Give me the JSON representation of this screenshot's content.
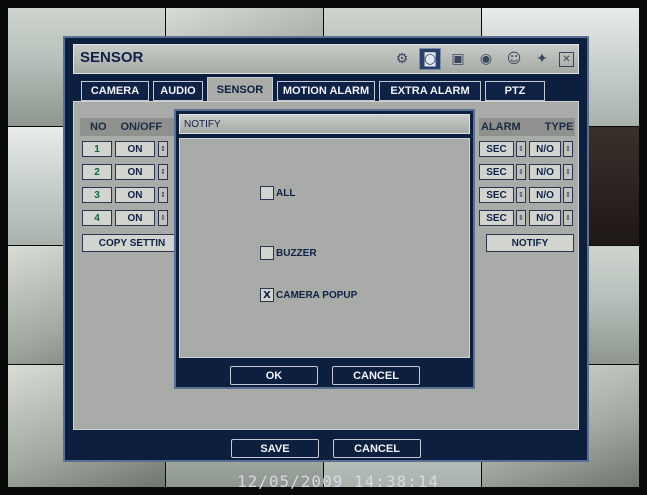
{
  "window": {
    "title": "SENSOR"
  },
  "toolbar_icons": [
    {
      "name": "gear-icon",
      "glyph": "⚙"
    },
    {
      "name": "camera-icon",
      "glyph": "◙"
    },
    {
      "name": "network-icon",
      "glyph": "▣"
    },
    {
      "name": "disk-icon",
      "glyph": "◉"
    },
    {
      "name": "user-icon",
      "glyph": "☺"
    },
    {
      "name": "alarm-icon",
      "glyph": "✦"
    },
    {
      "name": "close-icon",
      "glyph": "✕"
    }
  ],
  "tabs": [
    {
      "label": "CAMERA",
      "active": false
    },
    {
      "label": "AUDIO",
      "active": false
    },
    {
      "label": "SENSOR",
      "active": true
    },
    {
      "label": "MOTION ALARM",
      "active": false
    },
    {
      "label": "EXTRA ALARM",
      "active": false
    },
    {
      "label": "PTZ",
      "active": false
    }
  ],
  "table": {
    "headers": {
      "no": "NO",
      "onoff": "ON/OFF",
      "alarm": "ALARM",
      "type": "TYPE"
    },
    "rows": [
      {
        "no": "1",
        "onoff": "ON",
        "alarm": "SEC",
        "type": "N/O"
      },
      {
        "no": "2",
        "onoff": "ON",
        "alarm": "SEC",
        "type": "N/O"
      },
      {
        "no": "3",
        "onoff": "ON",
        "alarm": "SEC",
        "type": "N/O"
      },
      {
        "no": "4",
        "onoff": "ON",
        "alarm": "SEC",
        "type": "N/O"
      }
    ]
  },
  "copy_button": "COPY SETTIN",
  "notify_button": "NOTIFY",
  "footer": {
    "save": "SAVE",
    "cancel": "CANCEL"
  },
  "notify_dialog": {
    "title": "NOTIFY",
    "options": [
      {
        "label": "ALL",
        "checked": false,
        "mark": ""
      },
      {
        "label": "BUZZER",
        "checked": false,
        "mark": ""
      },
      {
        "label": "CAMERA POPUP",
        "checked": true,
        "mark": "X"
      }
    ],
    "ok": "OK",
    "cancel": "CANCEL"
  },
  "datetime": "12/05/2009 14:38:14"
}
